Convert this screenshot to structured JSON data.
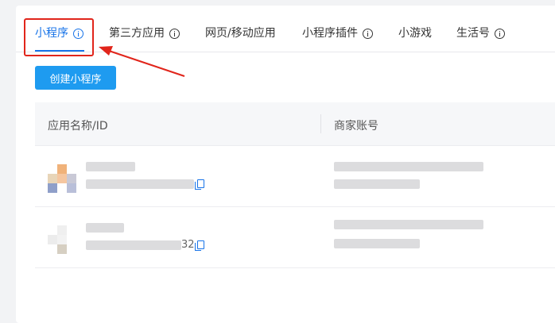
{
  "tabs": [
    {
      "label": "小程序",
      "active": true,
      "has_info_icon": true
    },
    {
      "label": "第三方应用",
      "active": false,
      "has_info_icon": true
    },
    {
      "label": "网页/移动应用",
      "active": false,
      "has_info_icon": false
    },
    {
      "label": "小程序插件",
      "active": false,
      "has_info_icon": true
    },
    {
      "label": "小游戏",
      "active": false,
      "has_info_icon": false
    },
    {
      "label": "生活号",
      "active": false,
      "has_info_icon": true
    }
  ],
  "create_button": {
    "label": "创建小程序"
  },
  "table": {
    "columns": [
      "应用名称/ID",
      "商家账号"
    ],
    "rows": [
      {
        "id_tail": "",
        "avatar_colors": [
          "#ffffff",
          "#f0b27a",
          "#ffffff",
          "#e8d5b8",
          "#f5c6a0",
          "#c9c9d6",
          "#8f9fc9",
          "#ffffff",
          "#b9bfd9"
        ]
      },
      {
        "id_tail": "32",
        "avatar_colors": [
          "#ffffff",
          "#efefef",
          "#ffffff",
          "#ececec",
          "#f2f2f2",
          "#ffffff",
          "#ffffff",
          "#d6cfc2",
          "#ffffff"
        ]
      }
    ]
  },
  "colors": {
    "accent": "#1773e8",
    "button": "#1e9bf0",
    "annotation_red": "#e1251b"
  }
}
